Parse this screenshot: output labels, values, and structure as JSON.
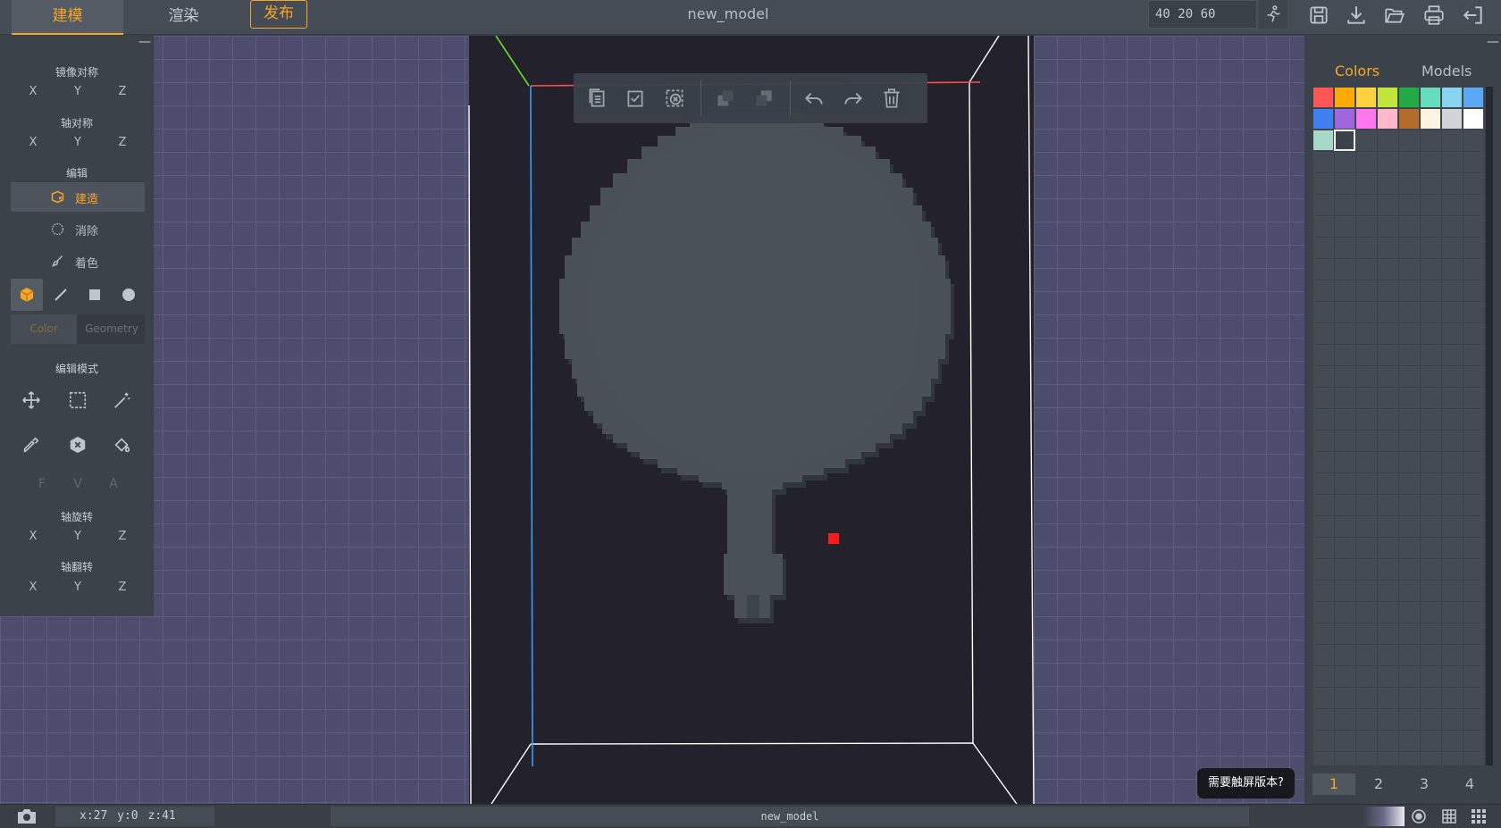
{
  "topbar": {
    "tab_model": "建模",
    "tab_render": "渲染",
    "publish": "发布",
    "title": "new_model",
    "dimensions": "40 20 60"
  },
  "left_panel": {
    "mirror_title": "镜像对称",
    "axis_sym_title": "轴对称",
    "edit_title": "编辑",
    "edit_build": "建造",
    "edit_erase": "消除",
    "edit_paint": "着色",
    "mode_color": "Color",
    "mode_geometry": "Geometry",
    "edit_mode_title": "编辑模式",
    "fva": [
      "F",
      "V",
      "A"
    ],
    "axis_rotate_title": "轴旋转",
    "axis_flip_title": "轴翻转",
    "axes": [
      "X",
      "Y",
      "Z"
    ]
  },
  "right_panel": {
    "tab_colors": "Colors",
    "tab_models": "Models",
    "palette": [
      "#ff5555",
      "#ffaa00",
      "#ffd23f",
      "#bfe63b",
      "#22aa44",
      "#66ddbb",
      "#88d4f0",
      "#5aa8f5",
      "#3f7ff0",
      "#a066dd",
      "#ff77ee",
      "#ffb8c8",
      "#b36d2b",
      "#fdf3e1",
      "#d0d3d7",
      "#ffffff",
      "#a8d8c8",
      "#3c424a"
    ],
    "selected_swatch_index": 17,
    "pages": [
      "1",
      "2",
      "3",
      "4"
    ],
    "active_page": "1"
  },
  "viewport": {
    "touch_tip": "需要触屏版本?"
  },
  "status": {
    "coords": "x:27 y:0 z:41",
    "model_name": "new_model"
  },
  "colors": {
    "accent": "#f5a623",
    "axis_x": "#ff4d4d",
    "axis_y": "#66dd22",
    "axis_z": "#3a9bff",
    "voxel": "#4a5059"
  },
  "icons": {
    "toolbar": [
      "copy-icon",
      "paste-icon",
      "clear-selection-icon",
      "layer-front-icon",
      "layer-back-icon",
      "undo-icon",
      "redo-icon",
      "trash-icon"
    ],
    "topbar": [
      "resize-icon",
      "save-icon",
      "download-icon",
      "open-folder-icon",
      "print-icon",
      "exit-icon"
    ],
    "status": [
      "camera-icon",
      "background-gradient",
      "target-icon",
      "grid-icon",
      "tiles-icon"
    ]
  }
}
